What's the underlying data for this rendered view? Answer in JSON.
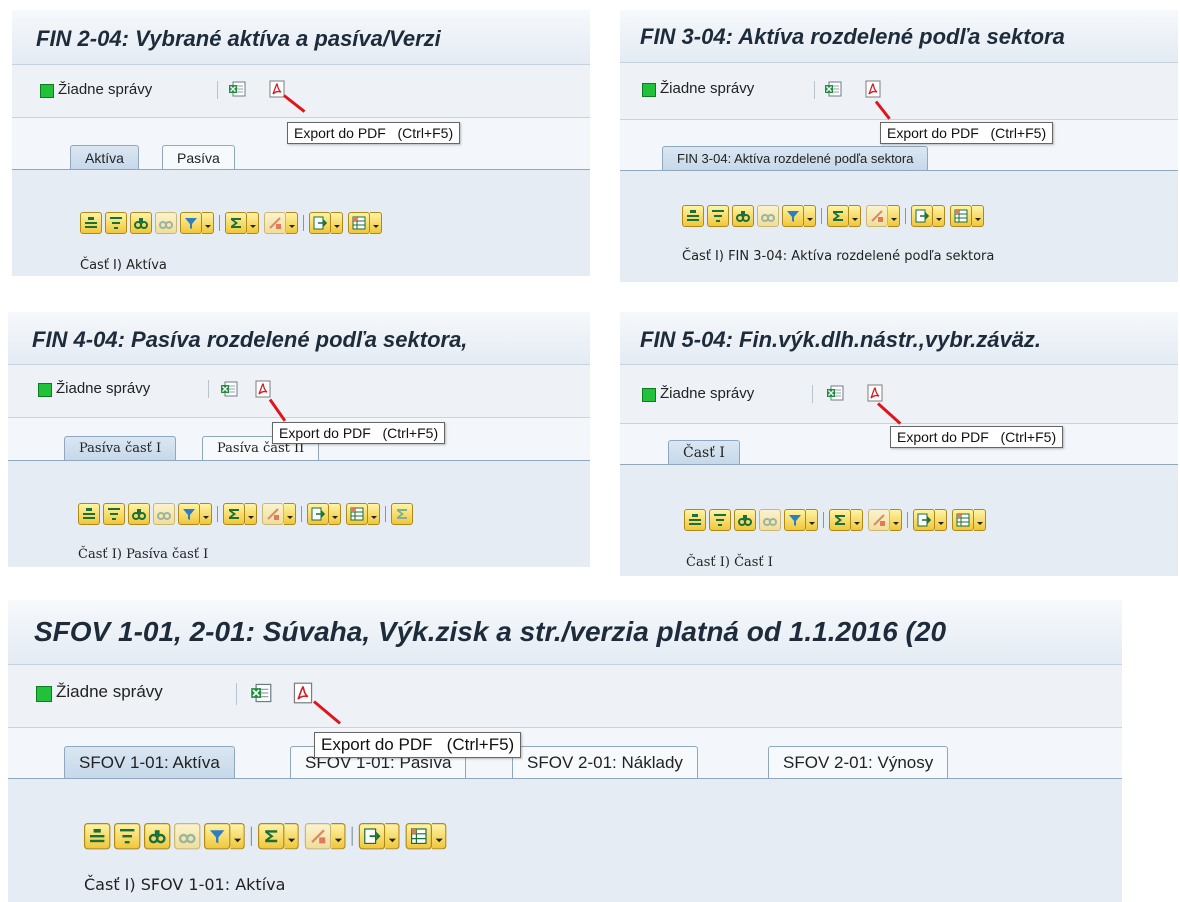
{
  "status_text": "Žiadne správy",
  "tooltip": {
    "label": "Export do PDF",
    "shortcut": "(Ctrl+F5)"
  },
  "icons": {
    "excel": "excel-export-icon",
    "pdf": "pdf-export-icon"
  },
  "colors": {
    "status_ok": "#22c13a",
    "annotation_line": "#e0151b",
    "button_face": "#f0c73a"
  },
  "panels": [
    {
      "title": "FIN 2-04: Vybrané aktíva a pasíva/Verzi",
      "tabs": [
        {
          "label": "Aktíva"
        },
        {
          "label": "Pasíva"
        }
      ],
      "section": "Časť I) Aktíva"
    },
    {
      "title": "FIN 3-04: Aktíva rozdelené podľa sektora",
      "tabs": [
        {
          "label": "FIN 3-04: Aktíva rozdelené podľa sektora"
        }
      ],
      "section": "Časť I) FIN 3-04: Aktíva rozdelené podľa sektora"
    },
    {
      "title": "FIN 4-04: Pasíva rozdelené podľa sektora,",
      "tabs": [
        {
          "label": "Pasíva časť I"
        },
        {
          "label": "Pasíva časť II"
        }
      ],
      "section": "Časť I) Pasíva časť I"
    },
    {
      "title": "FIN 5-04: Fin.výk.dlh.nástr.,vybr.záväz.",
      "tabs": [
        {
          "label": "Časť I"
        }
      ],
      "section": "Časť I) Časť I"
    },
    {
      "title": "SFOV 1-01, 2-01: Súvaha, Výk.zisk a str./verzia platná od 1.1.2016 (20",
      "tabs": [
        {
          "label": "SFOV 1-01: Aktíva"
        },
        {
          "label": "SFOV 1-01: Pasíva"
        },
        {
          "label": "SFOV 2-01: Náklady"
        },
        {
          "label": "SFOV 2-01: Výnosy"
        }
      ],
      "section": "Časť I) SFOV 1-01: Aktíva"
    }
  ]
}
